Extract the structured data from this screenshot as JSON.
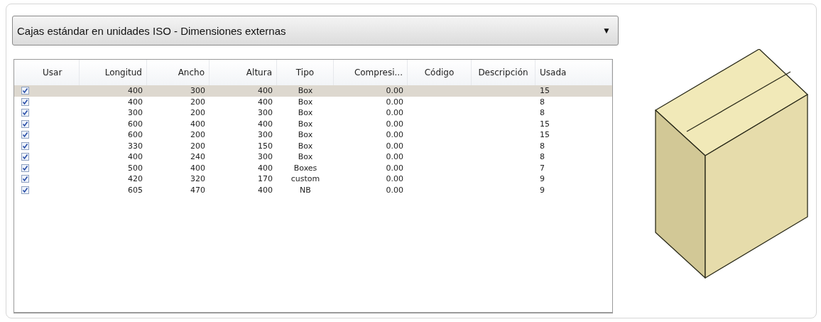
{
  "dropdown": {
    "value": "Cajas estándar en unidades ISO - Dimensiones externas",
    "arrow": "▼"
  },
  "table": {
    "columns": [
      "Usar",
      "Longitud",
      "Ancho",
      "Altura",
      "Tipo",
      "Compresi...",
      "Código",
      "Descripción",
      "Usada"
    ],
    "rows": [
      {
        "checked": true,
        "selected": true,
        "longitud": "400",
        "ancho": "300",
        "altura": "400",
        "tipo": "Box",
        "compresion": "0.00",
        "usada": "15"
      },
      {
        "checked": true,
        "selected": false,
        "longitud": "400",
        "ancho": "200",
        "altura": "400",
        "tipo": "Box",
        "compresion": "0.00",
        "usada": "8"
      },
      {
        "checked": true,
        "selected": false,
        "longitud": "300",
        "ancho": "200",
        "altura": "300",
        "tipo": "Box",
        "compresion": "0.00",
        "usada": "8"
      },
      {
        "checked": true,
        "selected": false,
        "longitud": "600",
        "ancho": "400",
        "altura": "400",
        "tipo": "Box",
        "compresion": "0.00",
        "usada": "15"
      },
      {
        "checked": true,
        "selected": false,
        "longitud": "600",
        "ancho": "200",
        "altura": "300",
        "tipo": "Box",
        "compresion": "0.00",
        "usada": "15"
      },
      {
        "checked": true,
        "selected": false,
        "longitud": "330",
        "ancho": "200",
        "altura": "150",
        "tipo": "Box",
        "compresion": "0.00",
        "usada": "8"
      },
      {
        "checked": true,
        "selected": false,
        "longitud": "400",
        "ancho": "240",
        "altura": "300",
        "tipo": "Box",
        "compresion": "0.00",
        "usada": "8"
      },
      {
        "checked": true,
        "selected": false,
        "longitud": "500",
        "ancho": "400",
        "altura": "400",
        "tipo": "Boxes",
        "compresion": "0.00",
        "usada": "7"
      },
      {
        "checked": true,
        "selected": false,
        "longitud": "420",
        "ancho": "320",
        "altura": "170",
        "tipo": "custom",
        "compresion": "0.00",
        "usada": "9"
      },
      {
        "checked": true,
        "selected": false,
        "longitud": "605",
        "ancho": "470",
        "altura": "400",
        "tipo": "NB",
        "compresion": "0.00",
        "usada": "9"
      }
    ]
  }
}
